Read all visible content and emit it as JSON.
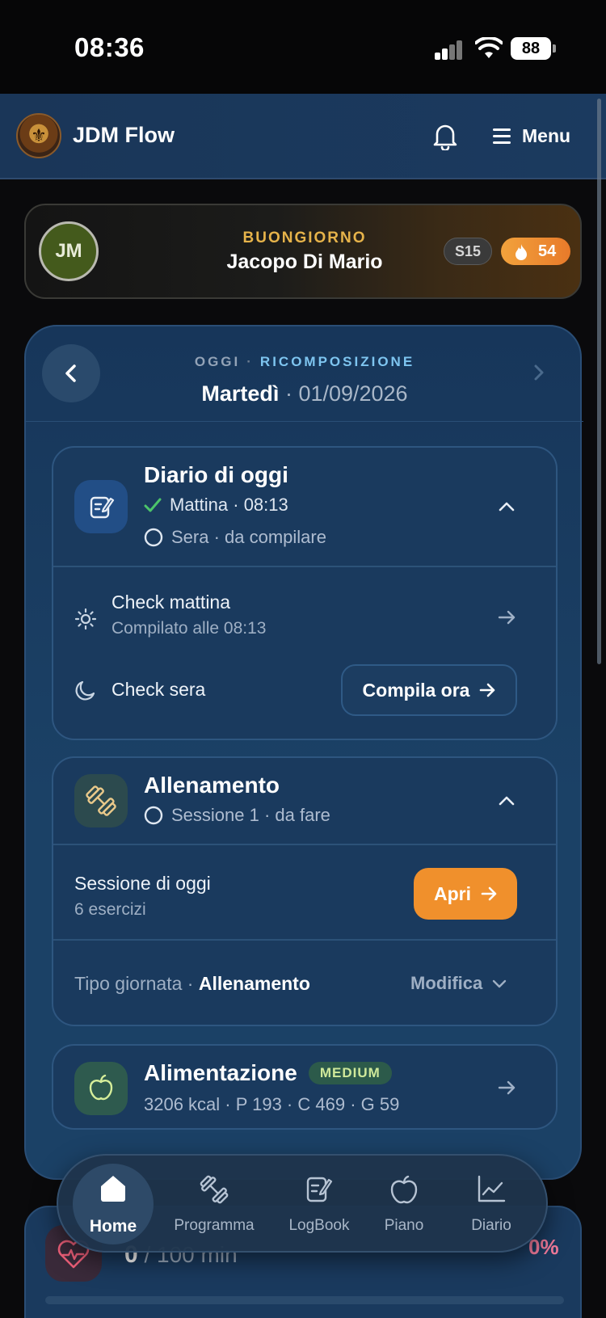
{
  "status_bar": {
    "time": "08:36",
    "battery": "88"
  },
  "app_bar": {
    "title": "JDM Flow",
    "menu_label": "Menu"
  },
  "greeting": {
    "initials": "JM",
    "kicker": "BUONGIORNO",
    "name": "Jacopo Di Mario",
    "season_badge": "S15",
    "streak": "54"
  },
  "day": {
    "kicker_left": "OGGI",
    "kicker_sep": "·",
    "kicker_right": "RICOMPOSIZIONE",
    "weekday": "Martedì",
    "date": "· 01/09/2026"
  },
  "diary": {
    "title": "Diario di oggi",
    "morning_status": "Mattina · 08:13",
    "evening_status": "Sera · da compilare",
    "check_morning": "Check mattina",
    "check_morning_sub": "Compilato alle 08:13",
    "check_evening": "Check sera",
    "compile_button": "Compila ora"
  },
  "training": {
    "title": "Allenamento",
    "status": "Sessione 1 · da fare",
    "session_label": "Sessione di oggi",
    "session_sub": "6 esercizi",
    "open_button": "Apri",
    "day_type_label": "Tipo giornata ·",
    "day_type_value": "Allenamento",
    "edit_label": "Modifica"
  },
  "nutrition": {
    "title": "Alimentazione",
    "level": "MEDIUM",
    "macros": "3206 kcal · P 193 · C 469 · G 59"
  },
  "cardio": {
    "value": "0",
    "target": "/ 100 min",
    "percent": "0%",
    "progress": 0
  },
  "tabs": [
    {
      "label": "Home",
      "icon": "home-icon",
      "active": true
    },
    {
      "label": "Programma",
      "icon": "dumbbell-icon",
      "active": false
    },
    {
      "label": "LogBook",
      "icon": "notebook-edit-icon",
      "active": false
    },
    {
      "label": "Piano",
      "icon": "apple-icon",
      "active": false
    },
    {
      "label": "Diario",
      "icon": "chart-line-icon",
      "active": false
    }
  ],
  "colors": {
    "accent_orange": "#f0902c",
    "kicker_gold": "#e6b34a",
    "kicker_blue": "#7ec5f0",
    "check_green": "#4cc46a",
    "cardio_pink": "#f07a9a"
  }
}
